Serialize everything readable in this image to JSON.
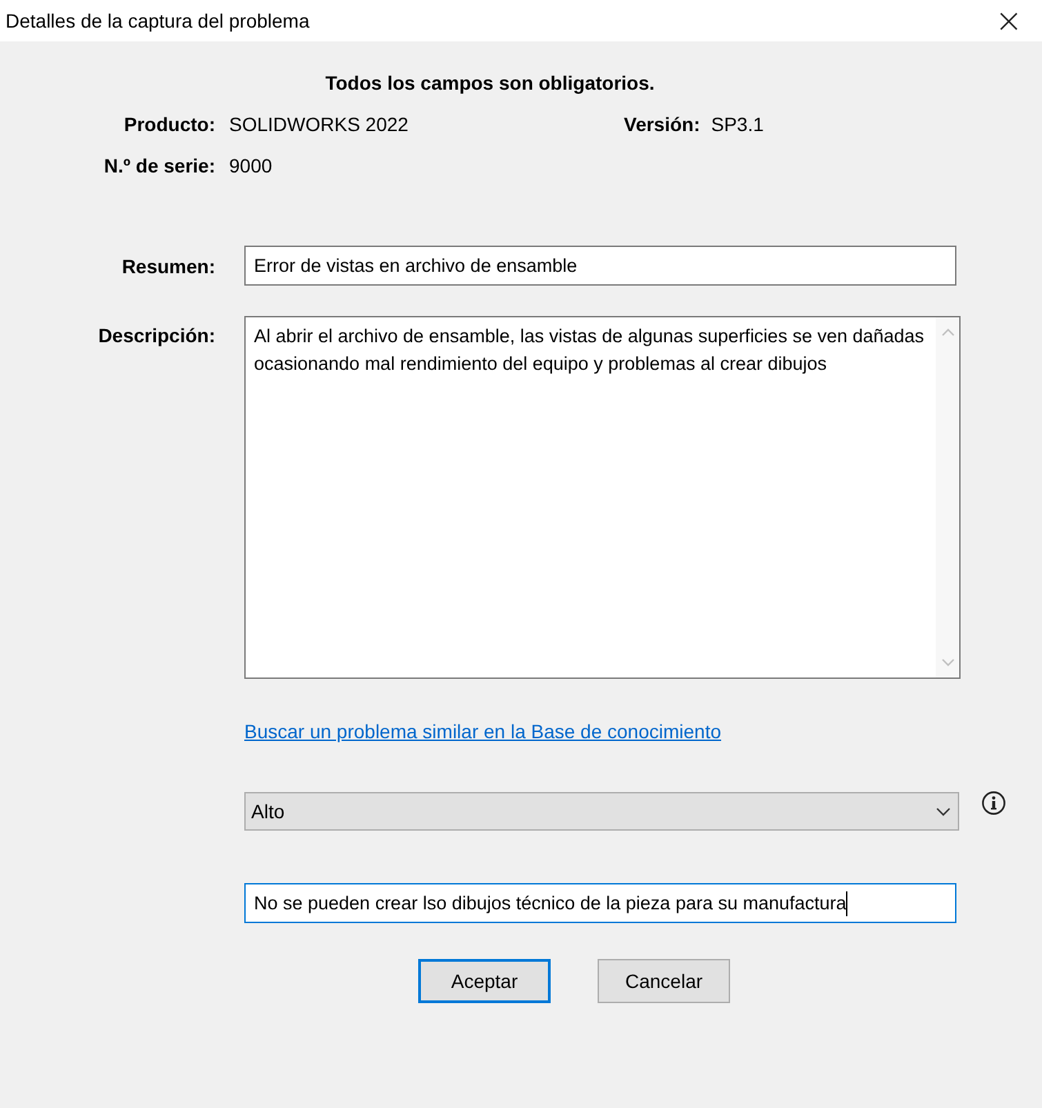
{
  "window": {
    "title": "Detalles de la captura del problema",
    "close": "×"
  },
  "notice": "Todos los campos son obligatorios.",
  "product": {
    "label": "Producto:",
    "value": "SOLIDWORKS 2022"
  },
  "version": {
    "label": "Versión:",
    "value": "SP3.1"
  },
  "serial": {
    "label": "N.º de serie:",
    "value": "9000"
  },
  "summary": {
    "label": "Resumen:",
    "value": "Error de vistas en archivo de ensamble",
    "focused": false
  },
  "description": {
    "label": "Descripción:",
    "value": "Al abrir el archivo de ensamble, las vistas de algunas superficies se ven dañadas ocasionando mal rendimiento del equipo y problemas al crear dibujos"
  },
  "kb_link": "Buscar un problema similar en la Base de conocimiento",
  "priority": {
    "value": "Alto"
  },
  "details": {
    "value": "No se pueden crear lso dibujos técnico de la pieza para su manufactura",
    "focused": true
  },
  "buttons": [
    {
      "label": "Aceptar",
      "default": true
    },
    {
      "label": "Cancelar",
      "default": false
    }
  ]
}
